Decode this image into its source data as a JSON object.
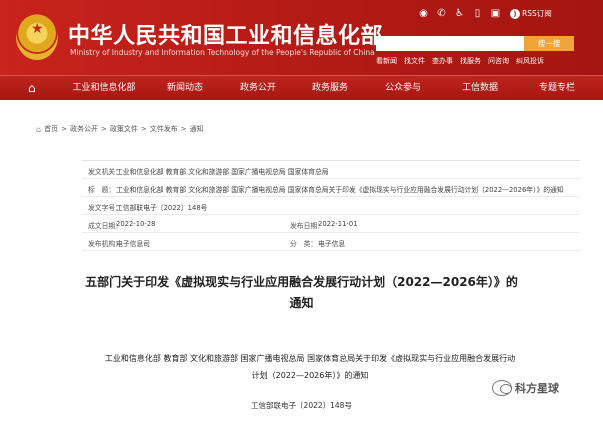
{
  "header": {
    "title": "中华人民共和国工业和信息化部",
    "subtitle": "Ministry of Industry and Information Technology of the People's Republic of China",
    "search_button": "搜一搜",
    "hot_links": [
      "看新闻",
      "找文件",
      "查办事",
      "找服务",
      "问咨询",
      "纠风投诉"
    ],
    "rss_label": "RSS订阅"
  },
  "nav": {
    "items": [
      "工业和信息化部",
      "新闻动态",
      "政务公开",
      "政务服务",
      "公众参与",
      "工信数据",
      "专题专栏"
    ]
  },
  "breadcrumb": [
    "首页",
    "政务公开",
    "政策文件",
    "文件发布",
    "通知"
  ],
  "info": {
    "rows": [
      {
        "k": "发文机关：",
        "v": "工业和信息化部 教育部 文化和旅游部 国家广播电视总局 国家体育总局"
      },
      {
        "k": "标　题：",
        "v": "工业和信息化部 教育部 文化和旅游部 国家广播电视总局 国家体育总局关于印发《虚拟现实与行业应用融合发展行动计划（2022—2026年）》的通知"
      },
      {
        "k": "发文字号：",
        "v": "工信部联电子〔2022〕148号"
      },
      {
        "k": "成文日期：",
        "v": "2022-10-28",
        "k2": "发布日期：",
        "v2": "2022-11-01"
      },
      {
        "k": "发布机构：",
        "v": "电子信息司",
        "k2": "分　类：",
        "v2": "电子信息"
      }
    ]
  },
  "doc": {
    "title_line1": "五部门关于印发《虚拟现实与行业应用融合发展行动计划（2022—2026年）》的",
    "title_line2": "通知",
    "issuers_line1": "工业和信息化部 教育部 文化和旅游部 国家广播电视总局 国家体育总局关于印发《虚拟现实与行业应用融合发展行动",
    "issuers_line2": "计划（2022—2026年）》的通知",
    "number": "工信部联电子〔2022〕148号"
  },
  "watermark": {
    "text": "科方星球"
  },
  "colors": {
    "brand_red": "#c8231c",
    "search_button": "#f0a43a"
  }
}
